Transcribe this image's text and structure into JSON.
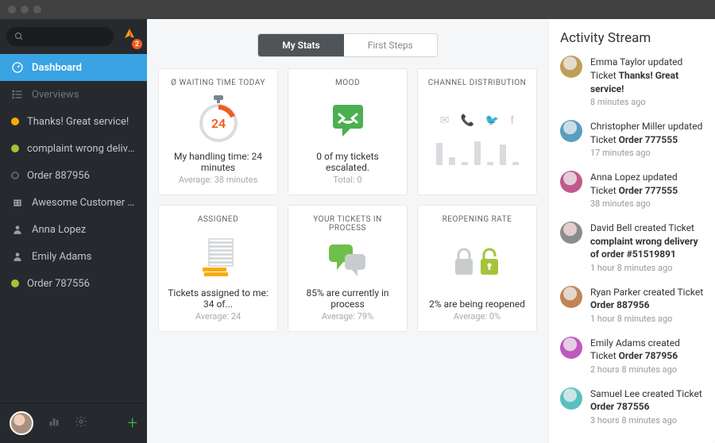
{
  "search_placeholder": "",
  "logo_badge": "2",
  "sidebar": {
    "dashboard": "Dashboard",
    "overviews": "Overviews",
    "items": [
      {
        "label": "Thanks! Great service!",
        "status": "open"
      },
      {
        "label": "complaint wrong delivery of ord...",
        "status": "closed"
      },
      {
        "label": "Order 887956",
        "status": "grey"
      },
      {
        "label": "Awesome Customer Inc.",
        "icon": "org"
      },
      {
        "label": "Anna Lopez",
        "icon": "user"
      },
      {
        "label": "Emily Adams",
        "icon": "user"
      },
      {
        "label": "Order 787556",
        "status": "closed"
      }
    ]
  },
  "tabs": {
    "my_stats": "My Stats",
    "first_steps": "First Steps"
  },
  "cards": {
    "waiting": {
      "title": "Ø WAITING TIME TODAY",
      "value": "24",
      "line": "My handling time: 24 minutes",
      "sub": "Average: 38 minutes"
    },
    "mood": {
      "title": "MOOD",
      "line": "0 of my tickets escalated.",
      "sub": "Total: 0"
    },
    "channel": {
      "title": "CHANNEL DISTRIBUTION",
      "bars": [
        28,
        10,
        4,
        30,
        4,
        26,
        4
      ]
    },
    "assigned": {
      "title": "ASSIGNED",
      "line": "Tickets assigned to me: 34 of...",
      "sub": "Average: 24"
    },
    "process": {
      "title": "YOUR TICKETS IN PROCESS",
      "line": "85% are currently in process",
      "sub": "Average: 79%"
    },
    "reopen": {
      "title": "REOPENING RATE",
      "line": "2% are being reopened",
      "sub": "Average: 0%"
    }
  },
  "activity": {
    "title": "Activity Stream",
    "items": [
      {
        "who": "Emma Taylor",
        "verb": "updated Ticket",
        "what": "Thanks! Great service!",
        "time": "8 minutes ago",
        "hue": 40
      },
      {
        "who": "Christopher Miller",
        "verb": "updated Ticket",
        "what": "Order 777555",
        "time": "17 minutes ago",
        "hue": 200
      },
      {
        "who": "Anna Lopez",
        "verb": "updated Ticket",
        "what": "Order 777555",
        "time": "38 minutes ago",
        "hue": 330
      },
      {
        "who": "David Bell",
        "verb": "created Ticket",
        "what": "complaint wrong delivery of order #51519891",
        "time": "1 hour 8 minutes ago",
        "hue": 0
      },
      {
        "who": "Ryan Parker",
        "verb": "created Ticket",
        "what": "Order 887956",
        "time": "1 hour 8 minutes ago",
        "hue": 25
      },
      {
        "who": "Emily Adams",
        "verb": "created Ticket",
        "what": "Order 787956",
        "time": "2 hours 8 minutes ago",
        "hue": 300
      },
      {
        "who": "Samuel Lee",
        "verb": "created Ticket",
        "what": "Order 787556",
        "time": "3 hours 8 minutes ago",
        "hue": 180
      }
    ]
  }
}
